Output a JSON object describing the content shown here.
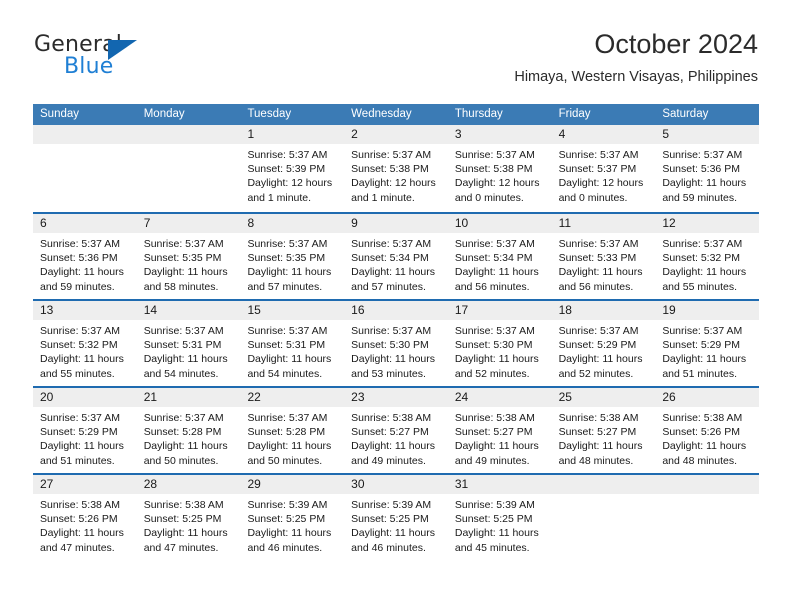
{
  "brand": {
    "name_part1": "General",
    "name_part2": "Blue",
    "triangle_color": "#1266b0",
    "blue_color": "#1f7fd4"
  },
  "header": {
    "title": "October 2024",
    "subtitle": "Himaya, Western Visayas, Philippines",
    "header_bg": "#3b7bb5",
    "row_divider": "#1f6bb0",
    "daynum_bg": "#eeeeee"
  },
  "weekdays": [
    "Sunday",
    "Monday",
    "Tuesday",
    "Wednesday",
    "Thursday",
    "Friday",
    "Saturday"
  ],
  "weeks": [
    [
      {
        "day": "",
        "empty": true
      },
      {
        "day": "",
        "empty": true
      },
      {
        "day": "1",
        "sunrise": "Sunrise: 5:37 AM",
        "sunset": "Sunset: 5:39 PM",
        "daylight1": "Daylight: 12 hours",
        "daylight2": "and 1 minute."
      },
      {
        "day": "2",
        "sunrise": "Sunrise: 5:37 AM",
        "sunset": "Sunset: 5:38 PM",
        "daylight1": "Daylight: 12 hours",
        "daylight2": "and 1 minute."
      },
      {
        "day": "3",
        "sunrise": "Sunrise: 5:37 AM",
        "sunset": "Sunset: 5:38 PM",
        "daylight1": "Daylight: 12 hours",
        "daylight2": "and 0 minutes."
      },
      {
        "day": "4",
        "sunrise": "Sunrise: 5:37 AM",
        "sunset": "Sunset: 5:37 PM",
        "daylight1": "Daylight: 12 hours",
        "daylight2": "and 0 minutes."
      },
      {
        "day": "5",
        "sunrise": "Sunrise: 5:37 AM",
        "sunset": "Sunset: 5:36 PM",
        "daylight1": "Daylight: 11 hours",
        "daylight2": "and 59 minutes."
      }
    ],
    [
      {
        "day": "6",
        "sunrise": "Sunrise: 5:37 AM",
        "sunset": "Sunset: 5:36 PM",
        "daylight1": "Daylight: 11 hours",
        "daylight2": "and 59 minutes."
      },
      {
        "day": "7",
        "sunrise": "Sunrise: 5:37 AM",
        "sunset": "Sunset: 5:35 PM",
        "daylight1": "Daylight: 11 hours",
        "daylight2": "and 58 minutes."
      },
      {
        "day": "8",
        "sunrise": "Sunrise: 5:37 AM",
        "sunset": "Sunset: 5:35 PM",
        "daylight1": "Daylight: 11 hours",
        "daylight2": "and 57 minutes."
      },
      {
        "day": "9",
        "sunrise": "Sunrise: 5:37 AM",
        "sunset": "Sunset: 5:34 PM",
        "daylight1": "Daylight: 11 hours",
        "daylight2": "and 57 minutes."
      },
      {
        "day": "10",
        "sunrise": "Sunrise: 5:37 AM",
        "sunset": "Sunset: 5:34 PM",
        "daylight1": "Daylight: 11 hours",
        "daylight2": "and 56 minutes."
      },
      {
        "day": "11",
        "sunrise": "Sunrise: 5:37 AM",
        "sunset": "Sunset: 5:33 PM",
        "daylight1": "Daylight: 11 hours",
        "daylight2": "and 56 minutes."
      },
      {
        "day": "12",
        "sunrise": "Sunrise: 5:37 AM",
        "sunset": "Sunset: 5:32 PM",
        "daylight1": "Daylight: 11 hours",
        "daylight2": "and 55 minutes."
      }
    ],
    [
      {
        "day": "13",
        "sunrise": "Sunrise: 5:37 AM",
        "sunset": "Sunset: 5:32 PM",
        "daylight1": "Daylight: 11 hours",
        "daylight2": "and 55 minutes."
      },
      {
        "day": "14",
        "sunrise": "Sunrise: 5:37 AM",
        "sunset": "Sunset: 5:31 PM",
        "daylight1": "Daylight: 11 hours",
        "daylight2": "and 54 minutes."
      },
      {
        "day": "15",
        "sunrise": "Sunrise: 5:37 AM",
        "sunset": "Sunset: 5:31 PM",
        "daylight1": "Daylight: 11 hours",
        "daylight2": "and 54 minutes."
      },
      {
        "day": "16",
        "sunrise": "Sunrise: 5:37 AM",
        "sunset": "Sunset: 5:30 PM",
        "daylight1": "Daylight: 11 hours",
        "daylight2": "and 53 minutes."
      },
      {
        "day": "17",
        "sunrise": "Sunrise: 5:37 AM",
        "sunset": "Sunset: 5:30 PM",
        "daylight1": "Daylight: 11 hours",
        "daylight2": "and 52 minutes."
      },
      {
        "day": "18",
        "sunrise": "Sunrise: 5:37 AM",
        "sunset": "Sunset: 5:29 PM",
        "daylight1": "Daylight: 11 hours",
        "daylight2": "and 52 minutes."
      },
      {
        "day": "19",
        "sunrise": "Sunrise: 5:37 AM",
        "sunset": "Sunset: 5:29 PM",
        "daylight1": "Daylight: 11 hours",
        "daylight2": "and 51 minutes."
      }
    ],
    [
      {
        "day": "20",
        "sunrise": "Sunrise: 5:37 AM",
        "sunset": "Sunset: 5:29 PM",
        "daylight1": "Daylight: 11 hours",
        "daylight2": "and 51 minutes."
      },
      {
        "day": "21",
        "sunrise": "Sunrise: 5:37 AM",
        "sunset": "Sunset: 5:28 PM",
        "daylight1": "Daylight: 11 hours",
        "daylight2": "and 50 minutes."
      },
      {
        "day": "22",
        "sunrise": "Sunrise: 5:37 AM",
        "sunset": "Sunset: 5:28 PM",
        "daylight1": "Daylight: 11 hours",
        "daylight2": "and 50 minutes."
      },
      {
        "day": "23",
        "sunrise": "Sunrise: 5:38 AM",
        "sunset": "Sunset: 5:27 PM",
        "daylight1": "Daylight: 11 hours",
        "daylight2": "and 49 minutes."
      },
      {
        "day": "24",
        "sunrise": "Sunrise: 5:38 AM",
        "sunset": "Sunset: 5:27 PM",
        "daylight1": "Daylight: 11 hours",
        "daylight2": "and 49 minutes."
      },
      {
        "day": "25",
        "sunrise": "Sunrise: 5:38 AM",
        "sunset": "Sunset: 5:27 PM",
        "daylight1": "Daylight: 11 hours",
        "daylight2": "and 48 minutes."
      },
      {
        "day": "26",
        "sunrise": "Sunrise: 5:38 AM",
        "sunset": "Sunset: 5:26 PM",
        "daylight1": "Daylight: 11 hours",
        "daylight2": "and 48 minutes."
      }
    ],
    [
      {
        "day": "27",
        "sunrise": "Sunrise: 5:38 AM",
        "sunset": "Sunset: 5:26 PM",
        "daylight1": "Daylight: 11 hours",
        "daylight2": "and 47 minutes."
      },
      {
        "day": "28",
        "sunrise": "Sunrise: 5:38 AM",
        "sunset": "Sunset: 5:25 PM",
        "daylight1": "Daylight: 11 hours",
        "daylight2": "and 47 minutes."
      },
      {
        "day": "29",
        "sunrise": "Sunrise: 5:39 AM",
        "sunset": "Sunset: 5:25 PM",
        "daylight1": "Daylight: 11 hours",
        "daylight2": "and 46 minutes."
      },
      {
        "day": "30",
        "sunrise": "Sunrise: 5:39 AM",
        "sunset": "Sunset: 5:25 PM",
        "daylight1": "Daylight: 11 hours",
        "daylight2": "and 46 minutes."
      },
      {
        "day": "31",
        "sunrise": "Sunrise: 5:39 AM",
        "sunset": "Sunset: 5:25 PM",
        "daylight1": "Daylight: 11 hours",
        "daylight2": "and 45 minutes."
      },
      {
        "day": "",
        "empty": true
      },
      {
        "day": "",
        "empty": true
      }
    ]
  ]
}
